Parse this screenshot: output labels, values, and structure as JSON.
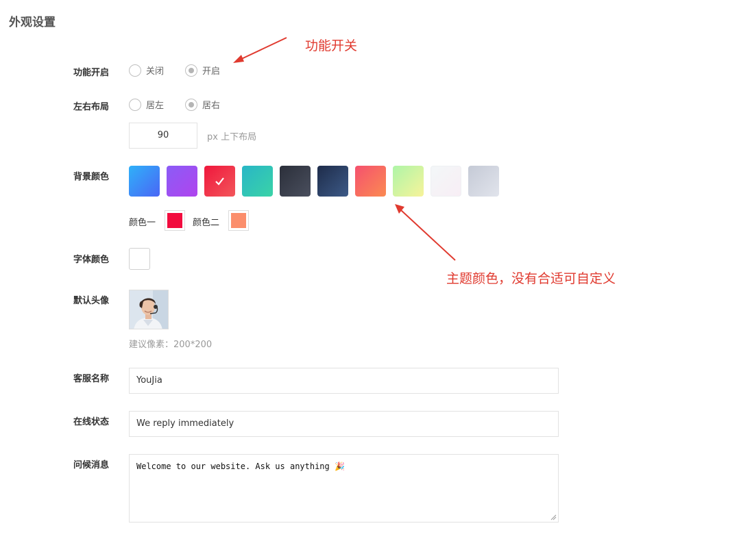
{
  "page": {
    "title": "外观设置"
  },
  "form": {
    "enable": {
      "label": "功能开启",
      "options": [
        "关闭",
        "开启"
      ],
      "selected": "开启"
    },
    "layout": {
      "label": "左右布局",
      "options": [
        "居左",
        "居右"
      ],
      "selected": "居右",
      "offset_value": "90",
      "offset_hint": "px 上下布局"
    },
    "background": {
      "label": "背景颜色",
      "swatches": [
        {
          "name": "blue",
          "from": "#2fb1f9",
          "to": "#4a66f5",
          "selected": false
        },
        {
          "name": "purple",
          "from": "#8b5cf6",
          "to": "#b044ee",
          "selected": false
        },
        {
          "name": "crimson",
          "from": "#f0173c",
          "to": "#f2565b",
          "selected": true
        },
        {
          "name": "teal",
          "from": "#29b6c6",
          "to": "#3ad3a7",
          "selected": false
        },
        {
          "name": "charcoal",
          "from": "#2b2f3a",
          "to": "#4a4f5e",
          "selected": false
        },
        {
          "name": "navy",
          "from": "#1e2c4a",
          "to": "#3d5a87",
          "selected": false
        },
        {
          "name": "coral",
          "from": "#f5516e",
          "to": "#fb8a52",
          "selected": false
        },
        {
          "name": "lime",
          "from": "#aef5a8",
          "to": "#f7f39a",
          "selected": false
        },
        {
          "name": "mist",
          "from": "#f3f7f8",
          "to": "#f8eef5",
          "selected": false
        },
        {
          "name": "silver",
          "from": "#c5cad6",
          "to": "#e1e4ec",
          "selected": false
        }
      ],
      "color1_label": "颜色一",
      "color1": "#f20c3e",
      "color2_label": "颜色二",
      "color2": "#fb8e6c"
    },
    "font_color": {
      "label": "字体颜色",
      "value": "#ffffff"
    },
    "avatar": {
      "label": "默认头像",
      "hint": "建议像素：200*200"
    },
    "agent_name": {
      "label": "客服名称",
      "value": "YouJia"
    },
    "online_status": {
      "label": "在线状态",
      "value": "We reply immediately"
    },
    "greeting": {
      "label": "问候消息",
      "value": "Welcome to our website. Ask us anything 🎉"
    }
  },
  "annotations": {
    "feature_switch": "功能开关",
    "theme_color": "主题颜色，没有合适可自定义"
  },
  "colors": {
    "accent_annotation": "#e03a2f"
  }
}
